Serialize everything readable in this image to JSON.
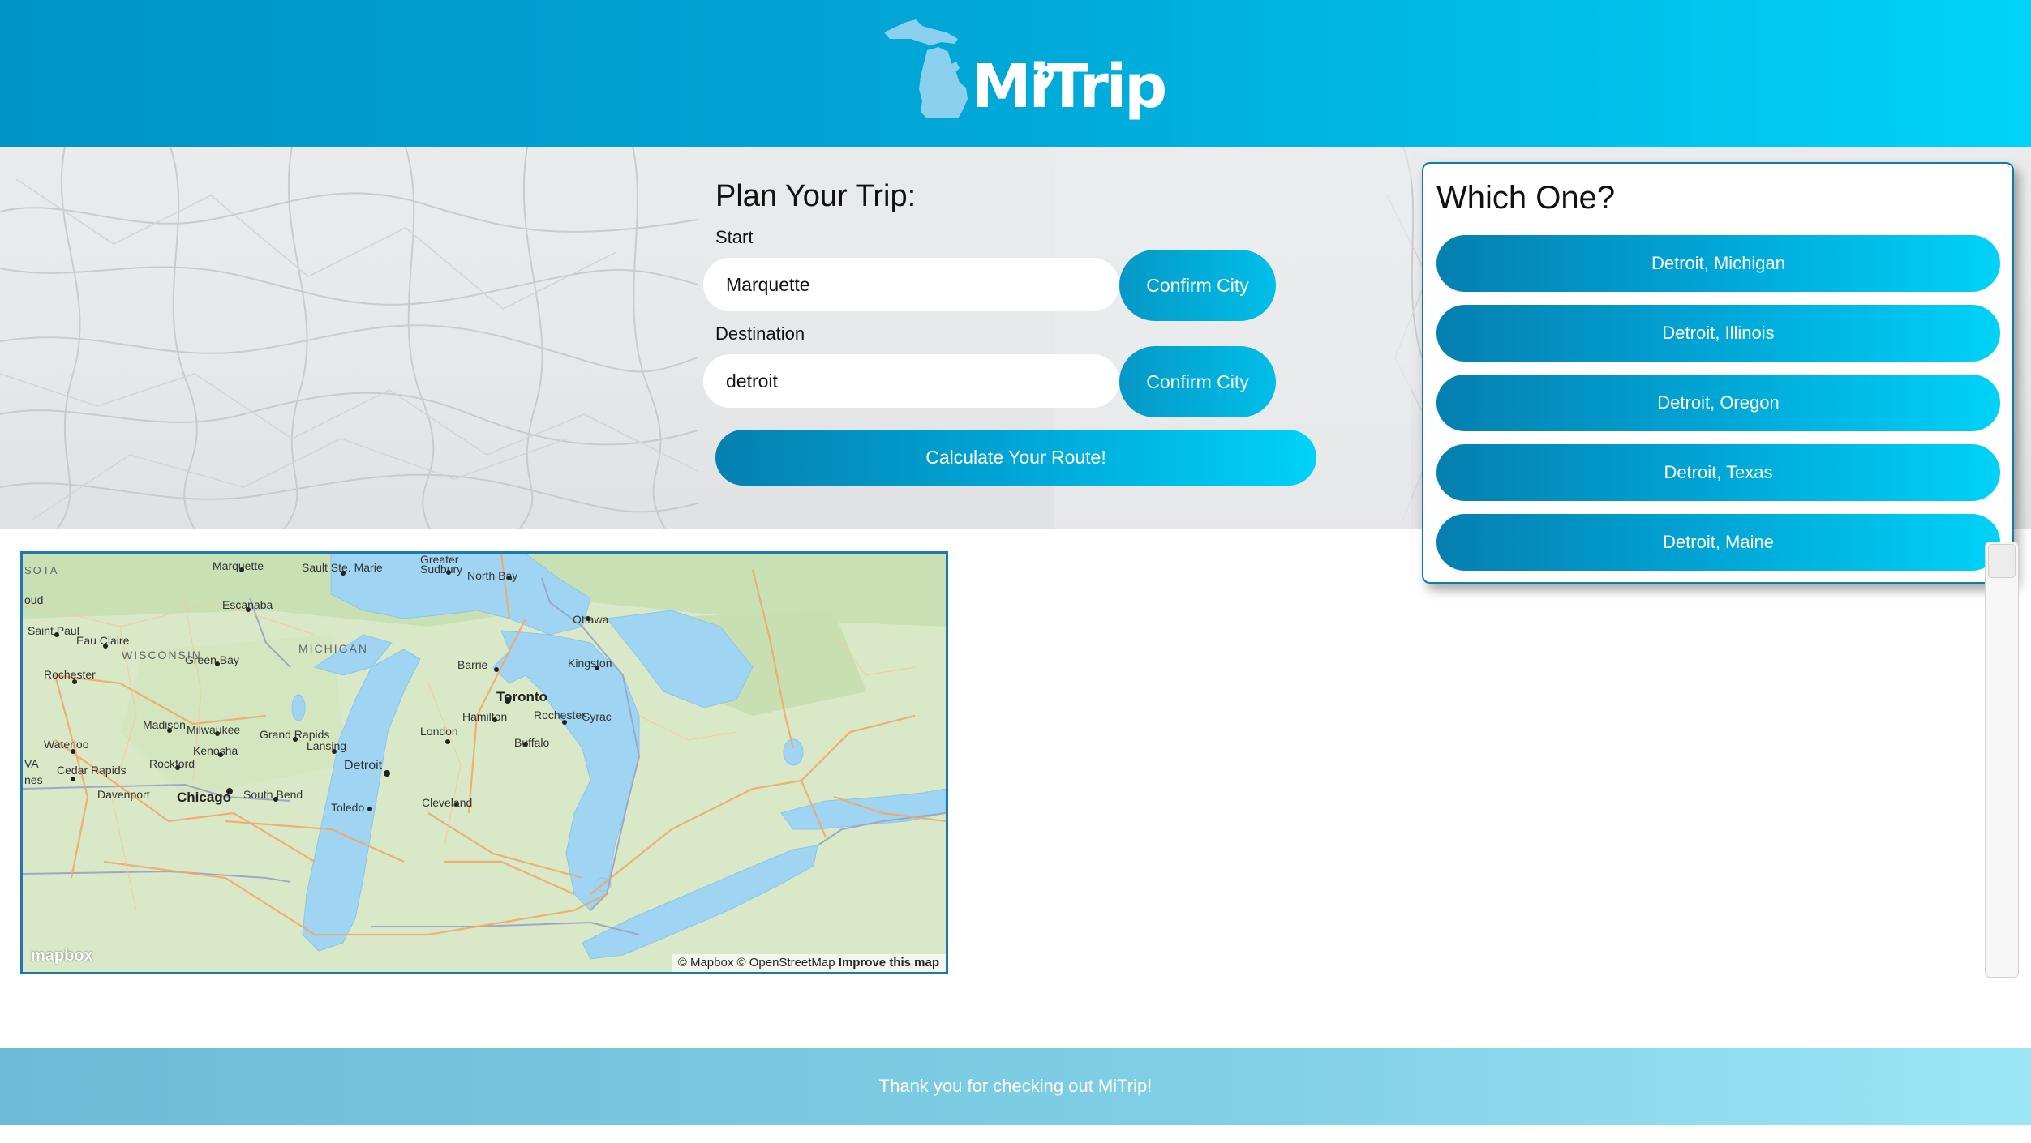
{
  "header": {
    "brand": "MiTrip"
  },
  "plan": {
    "title": "Plan Your Trip:",
    "start_label": "Start",
    "start_value": "Marquette",
    "destination_label": "Destination",
    "destination_value": "detroit",
    "confirm_label": "Confirm City",
    "calculate_label": "Calculate Your Route!"
  },
  "popup": {
    "title": "Which One?",
    "options": [
      "Detroit, Michigan",
      "Detroit, Illinois",
      "Detroit, Oregon",
      "Detroit, Texas",
      "Detroit, Maine"
    ]
  },
  "map": {
    "labels": {
      "marquette": "Marquette",
      "sault": "Sault Ste. Marie",
      "sudbury_1": "Greater",
      "sudbury_2": "Sudbury",
      "north_bay": "North Bay",
      "sota": "SOTA",
      "oud": "oud",
      "escanaba": "Escanaba",
      "ottawa": "Ottawa",
      "saint_paul": "Saint Paul",
      "eau_claire": "Eau Claire",
      "wisconsin": "WISCONSIN",
      "michigan": "MICHIGAN",
      "green_bay": "Green Bay",
      "barrie": "Barrie",
      "kingston": "Kingston",
      "rochester_mn": "Rochester",
      "toronto": "Toronto",
      "hamilton": "Hamilton",
      "rochester_ny": "Rochester",
      "syracuse": "Syrac",
      "madison": "Madison",
      "milwaukee": "Milwaukee",
      "grand_rapids": "Grand Rapids",
      "london": "London",
      "buffalo": "Buffalo",
      "waterloo": "Waterloo",
      "kenosha": "Kenosha",
      "lansing": "Lansing",
      "va": "VA",
      "rockford": "Rockford",
      "detroit": "Detroit",
      "cedar_rapids": "Cedar Rapids",
      "nes": "nes",
      "davenport": "Davenport",
      "chicago": "Chicago",
      "south_bend": "South Bend",
      "cleveland": "Cleveland",
      "toledo": "Toledo"
    },
    "mapbox_logo": "mapbox",
    "attribution": "© Mapbox © OpenStreetMap",
    "improve": "Improve this map"
  },
  "footer": {
    "text": "Thank you for checking out MiTrip!"
  },
  "colors": {
    "header_start": "#0094c6",
    "header_end": "#00d3f8",
    "accent": "#00a6d6",
    "water": "#9fd4f3",
    "land": "#d7e7c5"
  }
}
